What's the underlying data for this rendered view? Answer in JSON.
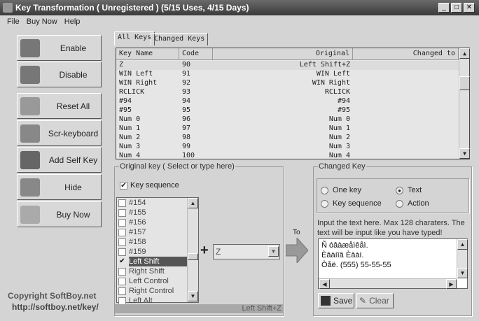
{
  "window": {
    "title": "Key Transformation ( Unregistered ) (5/15 Uses, 4/15 Days)",
    "minimize": "_",
    "maximize": "□",
    "close": "✕"
  },
  "menu": [
    "File",
    "Buy Now",
    "Help"
  ],
  "left_buttons": [
    {
      "label": "Enable",
      "icon": "gears-icon"
    },
    {
      "label": "Disable",
      "icon": "gears-icon"
    },
    {
      "label": "Reset All",
      "icon": "recycle-icon"
    },
    {
      "label": "Scr-keyboard",
      "icon": "computer-icon"
    },
    {
      "label": "Add Self Key",
      "icon": "pencil-icon"
    },
    {
      "label": "Hide",
      "icon": "running-man-icon"
    },
    {
      "label": "Buy Now",
      "icon": "cart-icon"
    }
  ],
  "copyright": "Copyright  SoftBoy.net",
  "website": "http://softboy.net/key/",
  "tabs": [
    "All Keys",
    "Changed Keys"
  ],
  "table": {
    "headers": [
      "Key Name",
      "Code",
      "Original",
      "Changed to"
    ],
    "rows": [
      [
        "Z",
        "90",
        "Left Shift+Z",
        ""
      ],
      [
        "WIN Left",
        "91",
        "WIN Left",
        ""
      ],
      [
        "WIN Right",
        "92",
        "WIN Right",
        ""
      ],
      [
        "RCLICK",
        "93",
        "RCLICK",
        ""
      ],
      [
        "#94",
        "94",
        "#94",
        ""
      ],
      [
        "#95",
        "95",
        "#95",
        ""
      ],
      [
        "Num 0",
        "96",
        "Num 0",
        ""
      ],
      [
        "Num 1",
        "97",
        "Num 1",
        ""
      ],
      [
        "Num 2",
        "98",
        "Num 2",
        ""
      ],
      [
        "Num 3",
        "99",
        "Num 3",
        ""
      ],
      [
        "Num 4",
        "100",
        "Num 4",
        ""
      ]
    ]
  },
  "original_key": {
    "legend": "Original key ( Select or type here)",
    "key_sequence_label": "Key sequence",
    "key_sequence_checked": true,
    "list": [
      {
        "label": "#154",
        "checked": false
      },
      {
        "label": "#155",
        "checked": false
      },
      {
        "label": "#156",
        "checked": false
      },
      {
        "label": "#157",
        "checked": false
      },
      {
        "label": "#158",
        "checked": false
      },
      {
        "label": "#159",
        "checked": false
      },
      {
        "label": "Left Shift",
        "checked": true
      },
      {
        "label": "Right Shift",
        "checked": false
      },
      {
        "label": "Left Control",
        "checked": false
      },
      {
        "label": "Right Control",
        "checked": false
      },
      {
        "label": "Left Alt",
        "checked": false
      }
    ],
    "plus": "+",
    "combo_value": "Z",
    "status": "Left Shift+Z"
  },
  "to_label": "To",
  "changed_key": {
    "legend": "Changed Key",
    "radios": [
      {
        "label": "One key",
        "selected": false
      },
      {
        "label": "Text",
        "selected": true
      },
      {
        "label": "Key sequence",
        "selected": false
      },
      {
        "label": "Action",
        "selected": false
      }
    ],
    "hint": "Input the text here. Max 128 charaters. The text will be input like you have typed!",
    "text_lines": [
      "Ñ óâàæåìêåì.",
      "Èâàíîâ Èâàí.",
      "Òåë. (555) 55-55-55"
    ],
    "save": "Save",
    "clear": "Clear"
  }
}
